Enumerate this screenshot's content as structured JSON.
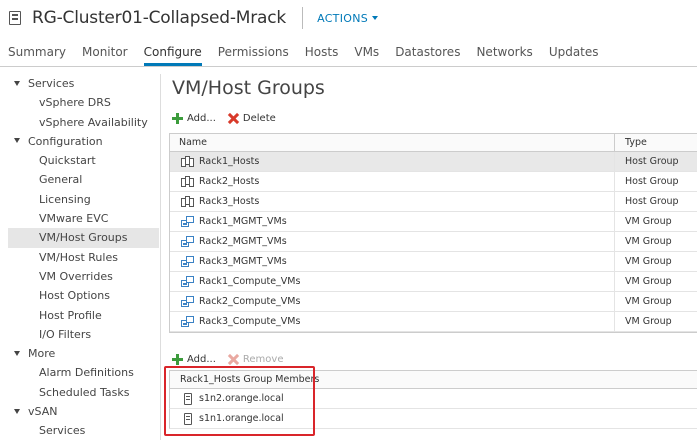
{
  "header": {
    "title": "RG-Cluster01-Collapsed-Mrack",
    "actions_label": "ACTIONS",
    "tabs": [
      {
        "label": "Summary"
      },
      {
        "label": "Monitor"
      },
      {
        "label": "Configure"
      },
      {
        "label": "Permissions"
      },
      {
        "label": "Hosts"
      },
      {
        "label": "VMs"
      },
      {
        "label": "Datastores"
      },
      {
        "label": "Networks"
      },
      {
        "label": "Updates"
      }
    ],
    "active_tab": "Configure"
  },
  "sidebar": {
    "groups": [
      {
        "label": "Services",
        "items": [
          {
            "label": "vSphere DRS"
          },
          {
            "label": "vSphere Availability"
          }
        ]
      },
      {
        "label": "Configuration",
        "items": [
          {
            "label": "Quickstart"
          },
          {
            "label": "General"
          },
          {
            "label": "Licensing"
          },
          {
            "label": "VMware EVC"
          },
          {
            "label": "VM/Host Groups"
          },
          {
            "label": "VM/Host Rules"
          },
          {
            "label": "VM Overrides"
          },
          {
            "label": "Host Options"
          },
          {
            "label": "Host Profile"
          },
          {
            "label": "I/O Filters"
          }
        ]
      },
      {
        "label": "More",
        "items": [
          {
            "label": "Alarm Definitions"
          },
          {
            "label": "Scheduled Tasks"
          }
        ]
      },
      {
        "label": "vSAN",
        "items": [
          {
            "label": "Services"
          }
        ]
      }
    ],
    "selected_item": "VM/Host Groups"
  },
  "main": {
    "page_title": "VM/Host Groups",
    "add_label": "Add...",
    "delete_label": "Delete",
    "columns": {
      "name": "Name",
      "type": "Type"
    },
    "rows": [
      {
        "name": "Rack1_Hosts",
        "type": "Host Group",
        "icon": "host-group-icon"
      },
      {
        "name": "Rack2_Hosts",
        "type": "Host Group",
        "icon": "host-group-icon"
      },
      {
        "name": "Rack3_Hosts",
        "type": "Host Group",
        "icon": "host-group-icon"
      },
      {
        "name": "Rack1_MGMT_VMs",
        "type": "VM Group",
        "icon": "vm-group-icon"
      },
      {
        "name": "Rack2_MGMT_VMs",
        "type": "VM Group",
        "icon": "vm-group-icon"
      },
      {
        "name": "Rack3_MGMT_VMs",
        "type": "VM Group",
        "icon": "vm-group-icon"
      },
      {
        "name": "Rack1_Compute_VMs",
        "type": "VM Group",
        "icon": "vm-group-icon"
      },
      {
        "name": "Rack2_Compute_VMs",
        "type": "VM Group",
        "icon": "vm-group-icon"
      },
      {
        "name": "Rack3_Compute_VMs",
        "type": "VM Group",
        "icon": "vm-group-icon"
      }
    ],
    "selected_row": "Rack1_Hosts",
    "members": {
      "add_label": "Add...",
      "remove_label": "Remove",
      "header": "Rack1_Hosts Group Members",
      "rows": [
        {
          "name": "s1n2.orange.local"
        },
        {
          "name": "s1n1.orange.local"
        }
      ]
    }
  },
  "colors": {
    "accent": "#0079b8",
    "add_green": "#3c9c3c",
    "delete_red": "#d83a2a",
    "highlight_red": "#d9252a",
    "selected_bg": "#e8e8e8"
  }
}
